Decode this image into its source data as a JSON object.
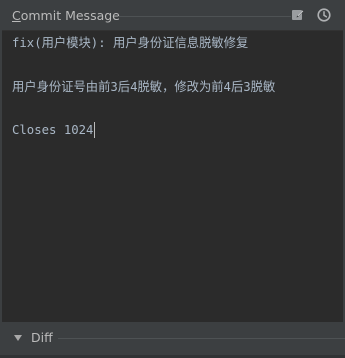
{
  "header": {
    "title": "Commit Message",
    "icons": {
      "edit": "edit-message-icon",
      "history": "history-clock-icon"
    }
  },
  "editor": {
    "lines": [
      "fix(用户模块): 用户身份证信息脱敏修复",
      "",
      "用户身份证号由前3后4脱敏，修改为前4后3脱敏",
      "",
      "Closes 1024"
    ]
  },
  "diff": {
    "label": "Diff",
    "collapsed": false
  },
  "colors": {
    "panel_bg": "#3c3f41",
    "editor_bg": "#2b2b2b",
    "text": "#a9b7c6",
    "label": "#bbbbbb"
  }
}
